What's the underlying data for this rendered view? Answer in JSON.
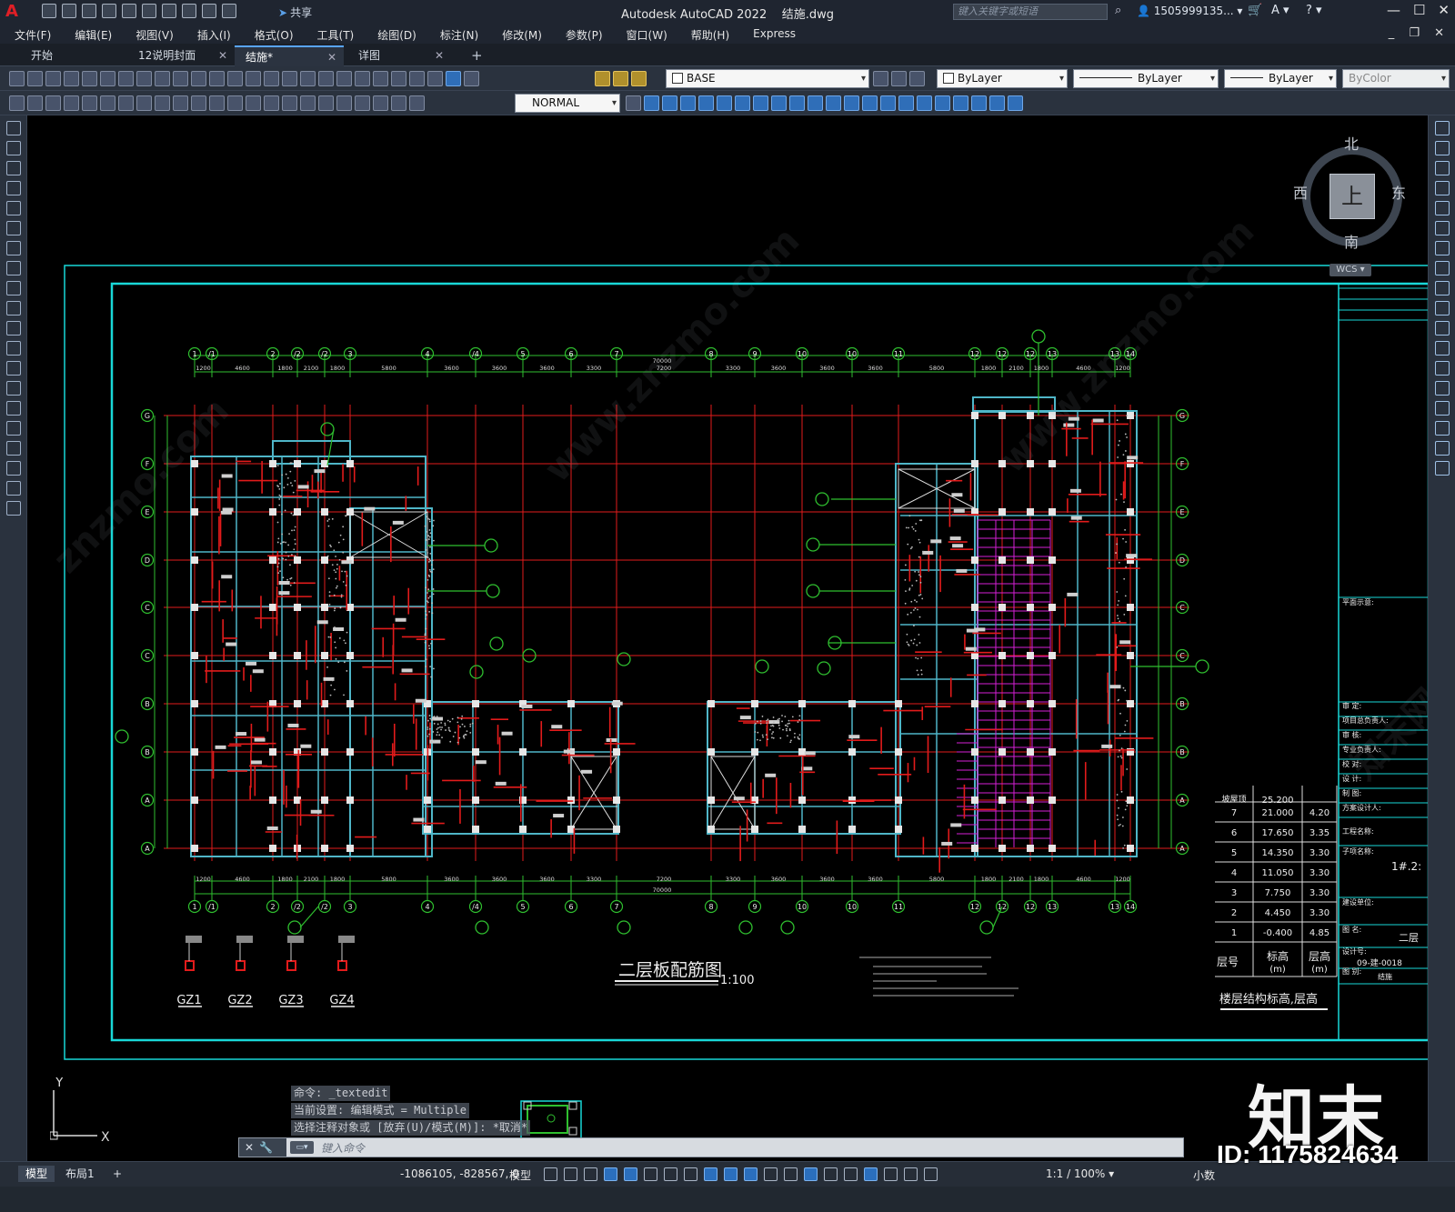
{
  "app": {
    "title": "Autodesk AutoCAD 2022",
    "file": "结施.dwg",
    "search_placeholder": "键入关键字或短语",
    "user": "1505999135...",
    "share": "共享"
  },
  "menu": [
    "文件(F)",
    "编辑(E)",
    "视图(V)",
    "插入(I)",
    "格式(O)",
    "工具(T)",
    "绘图(D)",
    "标注(N)",
    "修改(M)",
    "参数(P)",
    "窗口(W)",
    "帮助(H)",
    "Express"
  ],
  "tabs": [
    {
      "label": "开始",
      "closable": false,
      "active": false
    },
    {
      "label": "12说明封面",
      "closable": true,
      "active": false
    },
    {
      "label": "结施*",
      "closable": true,
      "active": true
    },
    {
      "label": "详图",
      "closable": true,
      "active": false
    }
  ],
  "props": {
    "layer": "BASE",
    "color": "ByLayer",
    "linetype": "ByLayer",
    "lineweight": "ByLayer",
    "plotstyle": "ByColor",
    "dimstyle": "NORMAL"
  },
  "viewcube": {
    "north": "北",
    "south": "南",
    "west": "西",
    "east": "东",
    "face": "上",
    "wcs": "WCS"
  },
  "drawing": {
    "title": "二层板配筋图",
    "scale": "1:100",
    "top_axes": [
      "1",
      "1/1",
      "2",
      "1/2",
      "1/2",
      "3",
      "4",
      "1/4",
      "5",
      "6",
      "7",
      "8",
      "9",
      "10",
      "1/10",
      "11",
      "12",
      "1/12",
      "1/12",
      "13",
      "1/13",
      "14"
    ],
    "bottom_axes": [
      "1",
      "1/1",
      "2",
      "1/2",
      "1/2",
      "3",
      "4",
      "1/4",
      "5",
      "6",
      "7",
      "8",
      "9",
      "10",
      "1/10",
      "11",
      "12",
      "1/12",
      "1/12",
      "13",
      "1/13",
      "14"
    ],
    "left_axes": [
      "G",
      "F",
      "E",
      "D",
      "1/C",
      "C",
      "1/B",
      "B",
      "1/A",
      "A"
    ],
    "top_dims": [
      "1200",
      "4600",
      "1800",
      "2100",
      "1800",
      "5800",
      "3600",
      "3600",
      "3600",
      "3300",
      "7200",
      "3300",
      "3600",
      "3600",
      "3600",
      "5800",
      "1800",
      "2100",
      "1800",
      "4600",
      "1200"
    ],
    "total_dim": "70000",
    "columns": [
      "GZ1",
      "GZ2",
      "GZ3",
      "GZ4"
    ]
  },
  "table": {
    "title": "楼层结构标高,层高",
    "header": {
      "floor": "层号",
      "elev": "标高\n(m)",
      "height": "层高\n(m)"
    },
    "roof": {
      "label": "坡屋顶",
      "elev": "25.200"
    },
    "rows": [
      {
        "floor": "7",
        "elev": "21.000",
        "height": "4.20"
      },
      {
        "floor": "6",
        "elev": "17.650",
        "height": "3.35"
      },
      {
        "floor": "5",
        "elev": "14.350",
        "height": "3.30"
      },
      {
        "floor": "4",
        "elev": "11.050",
        "height": "3.30"
      },
      {
        "floor": "3",
        "elev": "7.750",
        "height": "3.30"
      },
      {
        "floor": "2",
        "elev": "4.450",
        "height": "3.30"
      },
      {
        "floor": "1",
        "elev": "-0.400",
        "height": "4.85"
      }
    ]
  },
  "titleblock": {
    "labels": [
      "平面示意:",
      "审 定:",
      "项目总负责人:",
      "审 核:",
      "专业负责人:",
      "校 对:",
      "设 计:",
      "制 图:",
      "方案设计人:",
      "工程名称:",
      "子项名称:",
      "建设单位:",
      "图 名:",
      "设计号:",
      "图 别:"
    ],
    "subitem": "1#.2:",
    "drawing_name": "二层",
    "number": "09-建-0018",
    "sheet": "结施"
  },
  "command": {
    "history": [
      "命令: _textedit",
      "当前设置: 编辑模式 = Multiple",
      "选择注释对象或 [放弃(U)/模式(M)]: *取消*"
    ],
    "placeholder": "键入命令"
  },
  "status": {
    "tabs": [
      "模型",
      "布局1"
    ],
    "coords": "-1086105, -828567, 0",
    "mode": "模型",
    "scale": "1:1 / 100%",
    "units": "小数"
  },
  "brand": {
    "name": "知末",
    "id": "ID: 1175824634"
  },
  "colors": {
    "grid": "#e21b1b",
    "dim": "#2fbf2f",
    "wall": "#4fb6c8",
    "frame": "#19d8d8",
    "hatch": "#d61fd6"
  }
}
